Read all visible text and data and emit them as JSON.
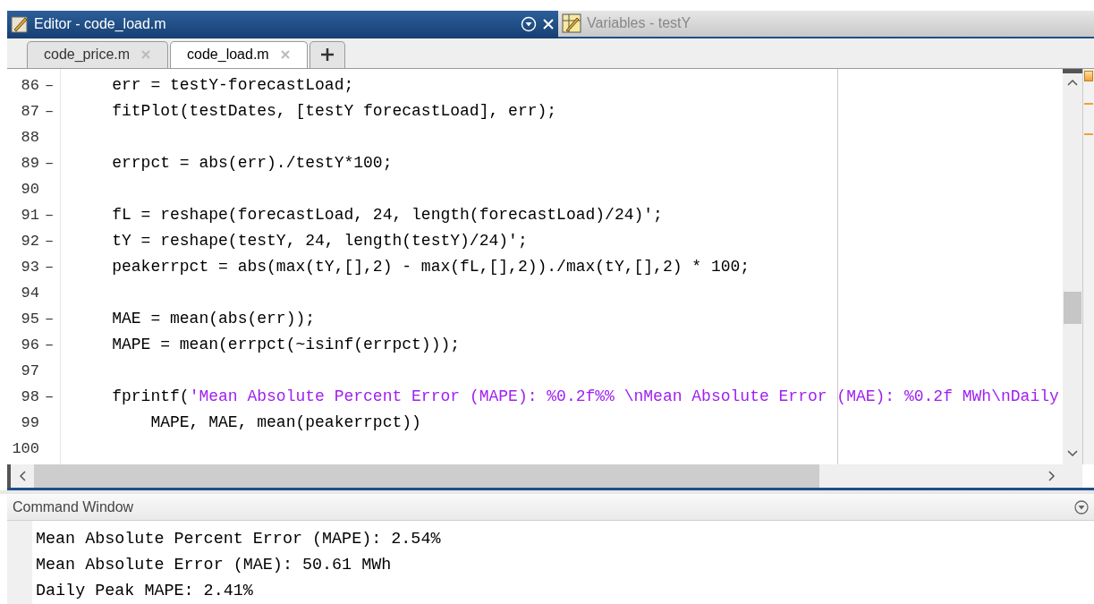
{
  "editor": {
    "title": "Editor - code_load.m"
  },
  "variables_panel": {
    "title": "Variables - testY"
  },
  "tabs": [
    {
      "label": "code_price.m",
      "selected": false
    },
    {
      "label": "code_load.m",
      "selected": true
    }
  ],
  "code_lines": [
    {
      "number": "86",
      "marker": "–",
      "tokens": [
        {
          "kind": "code",
          "text": "    err = testY-forecastLoad;"
        }
      ]
    },
    {
      "number": "87",
      "marker": "–",
      "tokens": [
        {
          "kind": "code",
          "text": "    fitPlot(testDates, [testY forecastLoad], err);"
        }
      ]
    },
    {
      "number": "88"
    },
    {
      "number": "89",
      "marker": "–",
      "tokens": [
        {
          "kind": "code",
          "text": "    errpct = abs(err)./testY*100;"
        }
      ]
    },
    {
      "number": "90"
    },
    {
      "number": "91",
      "marker": "–",
      "tokens": [
        {
          "kind": "code",
          "text": "    fL = reshape(forecastLoad, 24, length(forecastLoad)/24)';"
        }
      ]
    },
    {
      "number": "92",
      "marker": "–",
      "tokens": [
        {
          "kind": "code",
          "text": "    tY = reshape(testY, 24, length(testY)/24)';"
        }
      ]
    },
    {
      "number": "93",
      "marker": "–",
      "tokens": [
        {
          "kind": "code",
          "text": "    peakerrpct = abs(max(tY,[],2) - max(fL,[],2))./max(tY,[],2) * 100;"
        }
      ]
    },
    {
      "number": "94"
    },
    {
      "number": "95",
      "marker": "–",
      "tokens": [
        {
          "kind": "code",
          "text": "    MAE = mean(abs(err));"
        }
      ]
    },
    {
      "number": "96",
      "marker": "–",
      "tokens": [
        {
          "kind": "code",
          "text": "    MAPE = mean(errpct(~isinf(errpct)));"
        }
      ]
    },
    {
      "number": "97"
    },
    {
      "number": "98",
      "marker": "–",
      "tokens": [
        {
          "kind": "code",
          "text": "    fprintf("
        },
        {
          "kind": "string",
          "text": "'Mean Absolute Percent Error (MAPE): %0.2f%% \\nMean Absolute Error (MAE): %0.2f MWh\\nDaily"
        }
      ]
    },
    {
      "number": "99",
      "tokens": [
        {
          "kind": "code",
          "text": "        MAPE, MAE, mean(peakerrpct))"
        }
      ]
    },
    {
      "number": "100"
    }
  ],
  "command_window": {
    "title": "Command Window",
    "output": [
      "Mean Absolute Percent Error (MAPE): 2.54%",
      "Mean Absolute Error (MAE): 50.61 MWh",
      "Daily Peak MAPE: 2.41%"
    ]
  }
}
